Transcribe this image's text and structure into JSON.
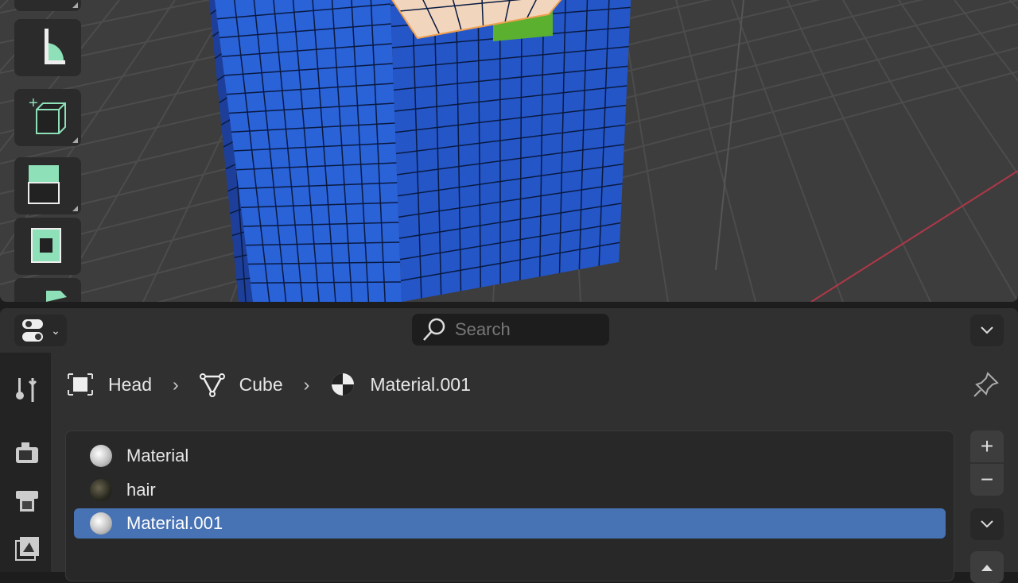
{
  "viewport": {
    "toolbar": [
      "transform-tool",
      "measure-tool",
      "add-cube-tool",
      "extrude-region-tool",
      "inset-faces-tool",
      "bevel-tool"
    ],
    "colors": {
      "background": "#3d3d3d",
      "mesh": "#2456c8",
      "skin": "#f1d6bd",
      "green": "#5cb030",
      "x_axis": "#b03848"
    }
  },
  "header": {
    "search_placeholder": "Search"
  },
  "breadcrumb": {
    "object": "Head",
    "mesh": "Cube",
    "material": "Material.001"
  },
  "materials": [
    {
      "name": "Material",
      "selected": false
    },
    {
      "name": "hair",
      "selected": false
    },
    {
      "name": "Material.001",
      "selected": true
    }
  ],
  "list_buttons": {
    "add": "+",
    "remove": "−"
  },
  "colors": {
    "selection": "#4772b3"
  }
}
